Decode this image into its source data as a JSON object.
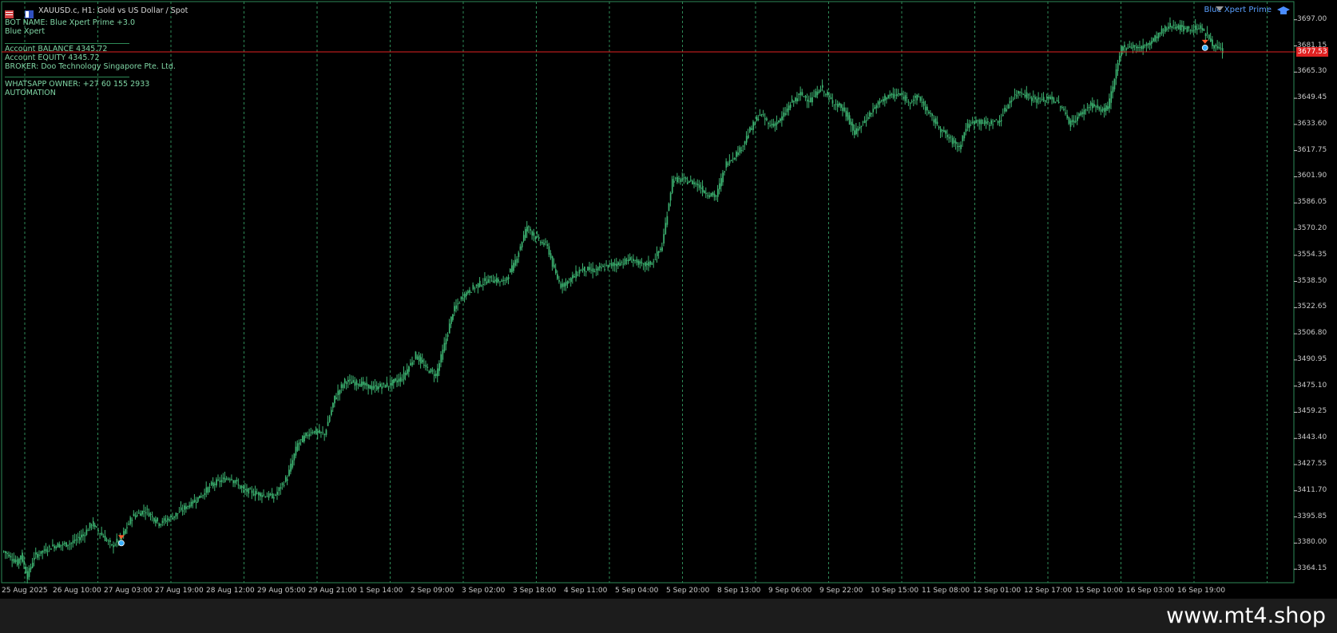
{
  "header": {
    "symbol_title": "XAUUSD.c, H1:  Gold vs US Dollar / Spot",
    "bot_name": "BOT NAME: Blue Xpert Prime +3.0",
    "bot_short": "Blue Xpert",
    "balance": "Account BALANCE  4345.72",
    "equity": "Account EQUITY   4345.72",
    "broker": "BROKER: Doo Technology Singapore Pte. Ltd.",
    "whatsapp": "WHATSAPP OWNER: +27 60 155 2933",
    "automation": "AUTOMATION"
  },
  "ea_label": "Blue Xpert Prime",
  "current_price": "3677.53",
  "watermark": "www.mt4.shop",
  "colors": {
    "candle": "#3cb371",
    "grid": "#2e8a57",
    "price_line": "#e02222",
    "axis_text": "#c8c8c8"
  },
  "y_axis": [
    "3697.00",
    "3681.15",
    "3665.30",
    "3649.45",
    "3633.60",
    "3617.75",
    "3601.90",
    "3586.05",
    "3570.20",
    "3554.35",
    "3538.50",
    "3522.65",
    "3506.80",
    "3490.95",
    "3475.10",
    "3459.25",
    "3443.40",
    "3427.55",
    "3411.70",
    "3395.85",
    "3380.00",
    "3364.15"
  ],
  "x_axis": [
    "25 Aug 2025",
    "26 Aug 10:00",
    "27 Aug 03:00",
    "27 Aug 19:00",
    "28 Aug 12:00",
    "29 Aug 05:00",
    "29 Aug 21:00",
    "1 Sep 14:00",
    "2 Sep 09:00",
    "3 Sep 02:00",
    "3 Sep 18:00",
    "4 Sep 11:00",
    "5 Sep 04:00",
    "5 Sep 20:00",
    "8 Sep 13:00",
    "9 Sep 06:00",
    "9 Sep 22:00",
    "10 Sep 15:00",
    "11 Sep 08:00",
    "12 Sep 01:00",
    "12 Sep 17:00",
    "15 Sep 10:00",
    "16 Sep 03:00",
    "16 Sep 19:00"
  ],
  "chart_data": {
    "type": "candlestick",
    "anchor_closes": [
      [
        0,
        3375
      ],
      [
        8,
        3368
      ],
      [
        10,
        3373
      ],
      [
        14,
        3360
      ],
      [
        18,
        3372
      ],
      [
        28,
        3378
      ],
      [
        40,
        3380
      ],
      [
        48,
        3386
      ],
      [
        52,
        3392
      ],
      [
        58,
        3385
      ],
      [
        64,
        3378
      ],
      [
        70,
        3384
      ],
      [
        76,
        3396
      ],
      [
        84,
        3400
      ],
      [
        92,
        3392
      ],
      [
        100,
        3396
      ],
      [
        108,
        3402
      ],
      [
        116,
        3408
      ],
      [
        124,
        3416
      ],
      [
        134,
        3420
      ],
      [
        142,
        3412
      ],
      [
        150,
        3410
      ],
      [
        160,
        3408
      ],
      [
        168,
        3420
      ],
      [
        174,
        3440
      ],
      [
        182,
        3448
      ],
      [
        190,
        3446
      ],
      [
        196,
        3468
      ],
      [
        202,
        3478
      ],
      [
        210,
        3477
      ],
      [
        218,
        3474
      ],
      [
        228,
        3476
      ],
      [
        236,
        3480
      ],
      [
        244,
        3494
      ],
      [
        250,
        3486
      ],
      [
        256,
        3482
      ],
      [
        260,
        3496
      ],
      [
        266,
        3520
      ],
      [
        272,
        3530
      ],
      [
        280,
        3536
      ],
      [
        288,
        3540
      ],
      [
        296,
        3538
      ],
      [
        302,
        3548
      ],
      [
        306,
        3560
      ],
      [
        310,
        3572
      ],
      [
        316,
        3564
      ],
      [
        322,
        3560
      ],
      [
        326,
        3545
      ],
      [
        330,
        3536
      ],
      [
        336,
        3540
      ],
      [
        342,
        3546
      ],
      [
        350,
        3545
      ],
      [
        358,
        3548
      ],
      [
        366,
        3550
      ],
      [
        372,
        3552
      ],
      [
        378,
        3548
      ],
      [
        384,
        3550
      ],
      [
        390,
        3560
      ],
      [
        396,
        3600
      ],
      [
        402,
        3600
      ],
      [
        410,
        3598
      ],
      [
        416,
        3592
      ],
      [
        422,
        3590
      ],
      [
        428,
        3610
      ],
      [
        436,
        3618
      ],
      [
        442,
        3630
      ],
      [
        448,
        3640
      ],
      [
        454,
        3633
      ],
      [
        460,
        3636
      ],
      [
        466,
        3646
      ],
      [
        472,
        3652
      ],
      [
        478,
        3648
      ],
      [
        484,
        3656
      ],
      [
        490,
        3648
      ],
      [
        496,
        3644
      ],
      [
        500,
        3638
      ],
      [
        504,
        3628
      ],
      [
        510,
        3636
      ],
      [
        516,
        3644
      ],
      [
        522,
        3650
      ],
      [
        530,
        3652
      ],
      [
        536,
        3648
      ],
      [
        542,
        3650
      ],
      [
        548,
        3640
      ],
      [
        554,
        3632
      ],
      [
        560,
        3625
      ],
      [
        566,
        3620
      ],
      [
        570,
        3632
      ],
      [
        576,
        3636
      ],
      [
        582,
        3634
      ],
      [
        590,
        3636
      ],
      [
        596,
        3648
      ],
      [
        602,
        3654
      ],
      [
        608,
        3650
      ],
      [
        614,
        3648
      ],
      [
        620,
        3650
      ],
      [
        626,
        3645
      ],
      [
        632,
        3634
      ],
      [
        638,
        3640
      ],
      [
        644,
        3646
      ],
      [
        650,
        3642
      ],
      [
        654,
        3644
      ],
      [
        658,
        3660
      ],
      [
        662,
        3680
      ],
      [
        668,
        3681
      ],
      [
        674,
        3680
      ],
      [
        680,
        3684
      ],
      [
        686,
        3690
      ],
      [
        692,
        3694
      ],
      [
        698,
        3692
      ],
      [
        704,
        3691
      ],
      [
        708,
        3693
      ],
      [
        714,
        3686
      ],
      [
        718,
        3680
      ],
      [
        722,
        3678
      ]
    ],
    "x_axis_labels": [
      "25 Aug 2025",
      "26 Aug 10:00",
      "27 Aug 03:00",
      "27 Aug 19:00",
      "28 Aug 12:00",
      "29 Aug 05:00",
      "29 Aug 21:00",
      "1 Sep 14:00",
      "2 Sep 09:00",
      "3 Sep 02:00",
      "3 Sep 18:00",
      "4 Sep 11:00",
      "5 Sep 04:00",
      "5 Sep 20:00",
      "8 Sep 13:00",
      "9 Sep 06:00",
      "9 Sep 22:00",
      "10 Sep 15:00",
      "11 Sep 08:00",
      "12 Sep 01:00",
      "12 Sep 17:00",
      "15 Sep 10:00",
      "16 Sep 03:00",
      "16 Sep 19:00"
    ],
    "ylim": [
      3356,
      3708
    ],
    "current_price": 3677.53,
    "trade_markers": [
      {
        "bar": 70,
        "price": 3380
      },
      {
        "bar": 712,
        "price": 3680
      }
    ]
  }
}
